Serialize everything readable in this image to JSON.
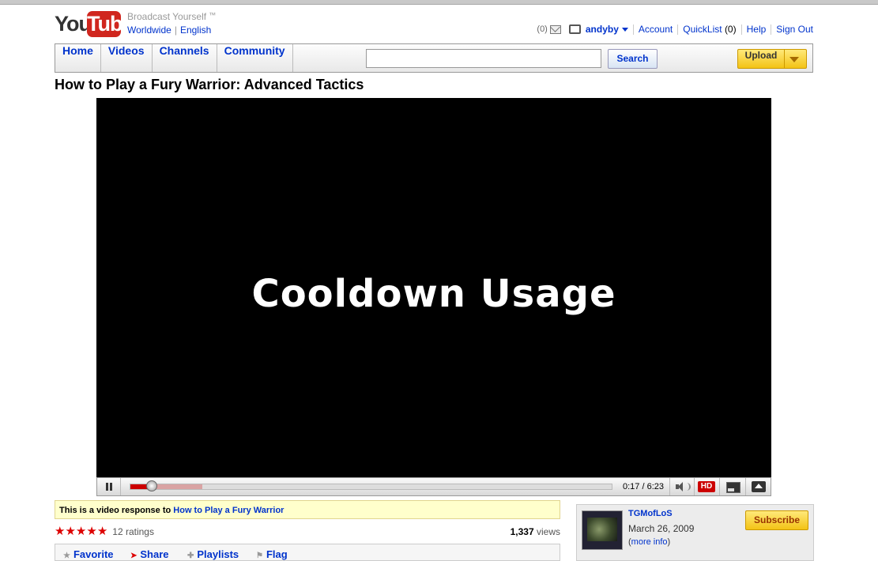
{
  "header": {
    "logo_you": "You",
    "logo_tube": "Tube",
    "tagline": "Broadcast Yourself",
    "trademark": "™",
    "locale_country": "Worldwide",
    "locale_language": "English"
  },
  "userbar": {
    "inbox_count": "(0)",
    "username": "andyby",
    "account": "Account",
    "quicklist": "QuickList",
    "quicklist_count": "(0)",
    "help": "Help",
    "signout": "Sign Out"
  },
  "nav": {
    "tabs": [
      "Home",
      "Videos",
      "Channels",
      "Community"
    ],
    "search_value": "",
    "search_button": "Search",
    "upload": "Upload"
  },
  "video": {
    "title": "How to Play a Fury Warrior: Advanced Tactics",
    "slide_text": "Cooldown Usage",
    "time": "0:17 / 6:23",
    "played_fraction": 0.045,
    "loaded_fraction": 0.15,
    "hd_label": "HD"
  },
  "response": {
    "prefix": "This is a video response to",
    "link": "How to Play a Fury Warrior"
  },
  "stats": {
    "stars": 5,
    "ratings": "12 ratings",
    "views_num": "1,337",
    "views_label": "views"
  },
  "actions": [
    "Favorite",
    "Share",
    "Playlists",
    "Flag"
  ],
  "uploader": {
    "name": "TGMofLoS",
    "date": "March 26, 2009",
    "more_open": "(",
    "more_info": "more info",
    "more_close": ")",
    "subscribe": "Subscribe"
  },
  "colors": {
    "link": "#0033cc",
    "brand_red": "#d0261e",
    "upload_yellow": "#f3c316"
  }
}
